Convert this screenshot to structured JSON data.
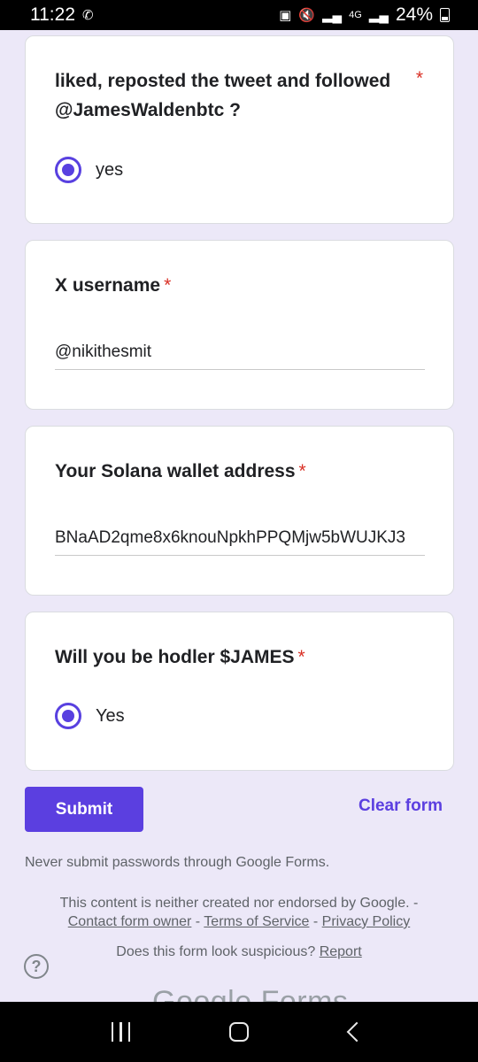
{
  "status_bar": {
    "time": "11:22",
    "call_icon": "wifi-call-icon",
    "network_label": "4G",
    "battery": "24%"
  },
  "questions": [
    {
      "text": "liked, reposted the tweet and followed @JamesWaldenbtc ?",
      "required_mark": "*",
      "type": "radio",
      "selected": "yes"
    },
    {
      "text": "X username",
      "required_mark": "*",
      "type": "text",
      "value": "@nikithesmit"
    },
    {
      "text": "Your Solana wallet address",
      "required_mark": "*",
      "type": "text",
      "value": "BNaAD2qme8x6knouNpkhPPQMjw5bWUJKJ3"
    },
    {
      "text": "Will you be hodler $JAMES",
      "required_mark": "*",
      "type": "radio",
      "selected": "Yes"
    }
  ],
  "actions": {
    "submit": "Submit",
    "clear": "Clear form"
  },
  "footer": {
    "note": "Never submit passwords through Google Forms.",
    "disclaimer": "This content is neither created nor endorsed by Google. -",
    "contact": "Contact form owner",
    "sep": " - ",
    "terms": "Terms of Service",
    "privacy": "Privacy Policy",
    "suspicious": "Does this form look suspicious?",
    "report": "Report",
    "help": "?",
    "brand": "Google Forms"
  },
  "colors": {
    "accent": "#5b3fe0",
    "required": "#d93025",
    "background": "#ece8f8"
  }
}
